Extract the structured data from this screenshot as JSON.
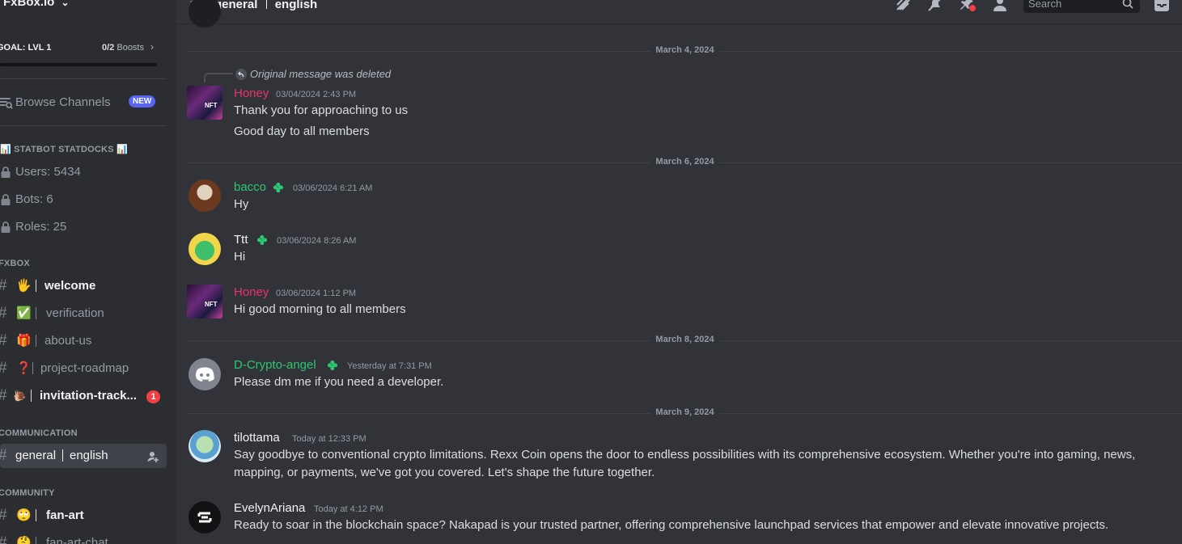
{
  "server": {
    "name": "FxBox.io",
    "boost_goal": "GOAL: LVL 1",
    "boost_count": "0/2",
    "boost_label": "Boosts"
  },
  "sidebar": {
    "browse_label": "Browse Channels",
    "new_badge": "NEW",
    "statbot_category": "📊 STATBOT STATDOCKS 📊",
    "statbot_items": [
      "Users: 5434",
      "Bots: 6",
      "Roles: 25"
    ],
    "fxbox_category": "FXBOX",
    "fxbox_channels": [
      {
        "emoji": "🖐",
        "name": "welcome"
      },
      {
        "emoji": "✅",
        "name": "verification"
      },
      {
        "emoji": "🎁",
        "name": "about-us"
      },
      {
        "emoji": "❓",
        "name": "project-roadmap"
      },
      {
        "emoji": "🐌",
        "name": "invitation-track...",
        "mentions": "1"
      }
    ],
    "communication_category": "COMMUNICATION",
    "active_channel": "general",
    "active_channel_sub": "english",
    "community_category": "COMMUNITY",
    "community_channels": [
      {
        "emoji": "🙄",
        "name": "fan-art"
      },
      {
        "emoji": "🤔",
        "name": "fan-art-chat"
      }
    ]
  },
  "topbar": {
    "title": "general",
    "title_sub": "english",
    "search_placeholder": "Search",
    "icons": [
      "threads-icon",
      "mute-bell-icon",
      "pin-icon",
      "members-icon",
      "inbox-icon"
    ]
  },
  "messages": {
    "date_1": "March 4, 2024",
    "reply_text": "Original message was deleted",
    "m1": {
      "author": "Honey",
      "time": "03/04/2024 2:43 PM",
      "lines": [
        "Thank you for approaching to us",
        "Good day to all members"
      ],
      "color": "#e6356a"
    },
    "date_2": "March 6, 2024",
    "m2": {
      "author": "bacco",
      "time": "03/06/2024 6:21 AM",
      "text": "Hy",
      "color": "#2dc770"
    },
    "m3": {
      "author": "Ttt",
      "time": "03/06/2024 8:26 AM",
      "text": "Hi",
      "color": "#f2f3f5"
    },
    "m4": {
      "author": "Honey",
      "time": "03/06/2024 1:12 PM",
      "text": "Hi good morning to all members",
      "color": "#e6356a"
    },
    "date_3": "March 8, 2024",
    "m5": {
      "author": "D-Crypto-angel",
      "time": "Yesterday at 7:31 PM",
      "text": "Please dm me if you need a developer.",
      "color": "#2dc770"
    },
    "date_4": "March 9, 2024",
    "m6": {
      "author": "tilottama",
      "time": "Today at 12:33 PM",
      "lines": [
        "Say goodbye to conventional crypto limitations. Rexx Coin opens the door to endless possibilities with its comprehensive ecosystem. Whether you're into gaming, news,",
        "mapping, or payments, we've got you covered. Let's shape the future together."
      ],
      "color": "#f2f3f5"
    },
    "m7": {
      "author": "EvelynAriana",
      "time": "Today at 4:12 PM",
      "text": "Ready to soar in the blockchain space? Nakapad is your trusted partner, offering comprehensive launchpad services that empower and elevate innovative projects.",
      "color": "#f2f3f5"
    }
  }
}
